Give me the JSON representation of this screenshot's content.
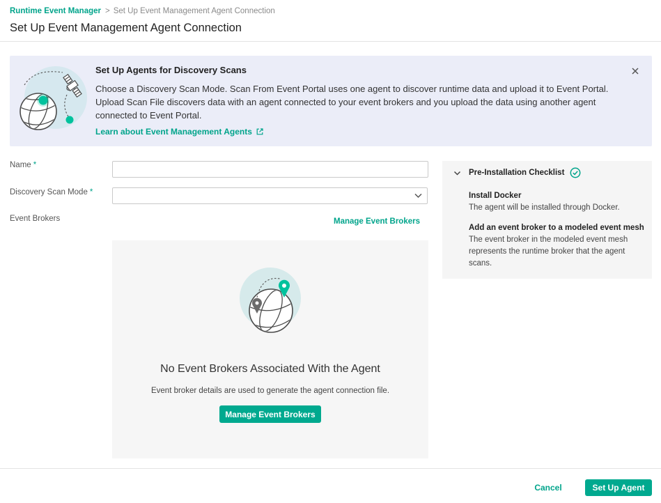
{
  "colors": {
    "accent": "#00a98f",
    "accent_text": "#00a48b",
    "banner_bg": "#ebedf8",
    "panel_bg": "#f6f6f6"
  },
  "breadcrumb": {
    "parent": "Runtime Event Manager",
    "separator": ">",
    "current": "Set Up Event Management Agent Connection"
  },
  "page_title": "Set Up Event Management Agent Connection",
  "banner": {
    "illustration": "globe-satellite-illustration",
    "title": "Set Up Agents for Discovery Scans",
    "body": "Choose a Discovery Scan Mode. Scan From Event Portal uses one agent to discover runtime data and upload it to Event Portal. Upload Scan File discovers data with an agent connected to your event brokers and you upload the data using another agent connected to Event Portal.",
    "link_label": "Learn about Event Management Agents",
    "link_icon": "external-link-icon",
    "close_icon": "close-icon"
  },
  "form": {
    "name": {
      "label": "Name",
      "required_marker": "*",
      "value": ""
    },
    "discovery_scan_mode": {
      "label": "Discovery Scan Mode",
      "required_marker": "*",
      "value": "",
      "icon": "chevron-down-icon"
    },
    "event_brokers": {
      "label": "Event Brokers",
      "manage_link": "Manage Event Brokers",
      "empty_state": {
        "illustration": "globe-pin-illustration",
        "title": "No Event Brokers Associated With the Agent",
        "description": "Event broker details are used to generate the agent connection file.",
        "button_label": "Manage Event Brokers"
      }
    }
  },
  "checklist": {
    "title": "Pre-Installation Checklist",
    "expanded": true,
    "toggle_icon": "chevron-down-icon",
    "status_icon": "check-circle-icon",
    "items": [
      {
        "title": "Install Docker",
        "description": "The agent will be installed through Docker."
      },
      {
        "title": "Add an event broker to a modeled event mesh",
        "description": "The event broker in the modeled event mesh represents the runtime broker that the agent scans."
      }
    ]
  },
  "footer": {
    "cancel_label": "Cancel",
    "submit_label": "Set Up Agent"
  }
}
